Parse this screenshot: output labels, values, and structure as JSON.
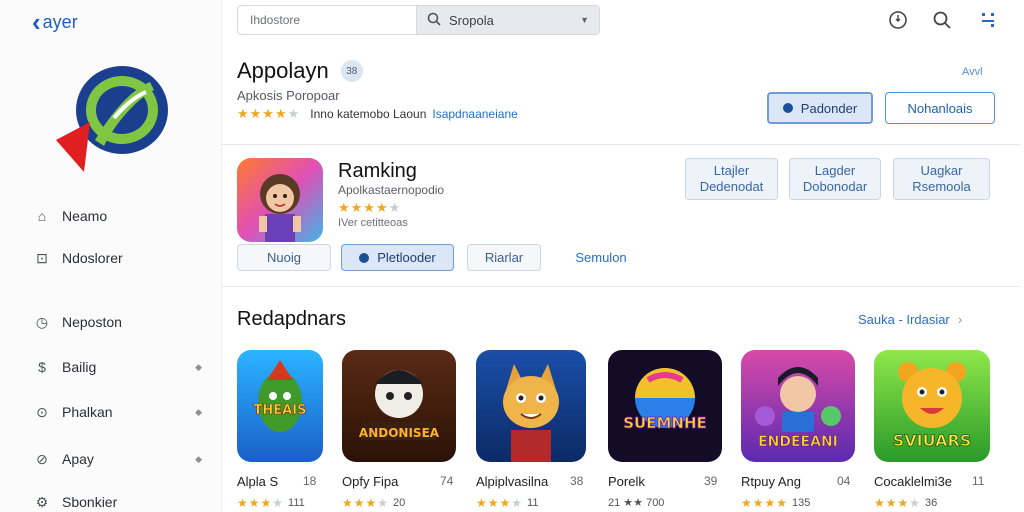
{
  "sidebar": {
    "back_label": "ayer",
    "items": [
      {
        "label": "Neamo",
        "icon": "home-icon",
        "has_arrow": false
      },
      {
        "label": "Ndoslorer",
        "icon": "square-icon",
        "has_arrow": false
      },
      {
        "label": "Neposton",
        "icon": "clock-icon",
        "has_arrow": false
      },
      {
        "label": "Bailig",
        "icon": "dollar-icon",
        "has_arrow": true
      },
      {
        "label": "Phalkan",
        "icon": "dollar-circle-icon",
        "has_arrow": true
      },
      {
        "label": "Apay",
        "icon": "compass-icon",
        "has_arrow": true
      },
      {
        "label": "Sbonkier",
        "icon": "gear-icon",
        "has_arrow": false
      }
    ]
  },
  "topbar": {
    "search_value": "Ihdostore",
    "search_scope": "Sropola"
  },
  "app": {
    "title": "Appolayn",
    "badge": "38",
    "subtitle": "Apkosis Poropoar",
    "rating_text": "Inno katemobo Laoun",
    "rating_link": "Isapdnaaneiane",
    "corner_link": "Avvl",
    "btn_primary": "Padonder",
    "btn_secondary": "Nohanloais"
  },
  "ranking": {
    "title": "Ramking",
    "subtitle": "Apolkastaernopodio",
    "meta": "IVer cetitteoas",
    "btn1": "Nuoig",
    "btn2": "Pletlooder",
    "btn3": "Riarlar",
    "btn4": "Semulon",
    "side_btn1_line1": "Ltajler",
    "side_btn1_line2": "Dedenodat",
    "side_btn2_line1": "Lagder",
    "side_btn2_line2": "Dobonodar",
    "side_btn3_line1": "Uagkar",
    "side_btn3_line2": "Rsemoola"
  },
  "recommendations": {
    "title": "Redapdnars",
    "see_all": "Sauka - Irdasiar",
    "apps": [
      {
        "name": "Alpla S",
        "num": "18",
        "rating_text": "111",
        "art_text": "THEAIS",
        "stars": 3
      },
      {
        "name": "Opfy Fipa",
        "num": "74",
        "rating_text": "20",
        "art_text": "ANDONISEA",
        "stars": 3
      },
      {
        "name": "Alpiplvasilna",
        "num": "38",
        "rating_text": "11",
        "art_text": "",
        "stars": 3
      },
      {
        "name": "Porelk",
        "num": "39",
        "rating_text": "21 ★★ 700",
        "art_text": "SUEMNHE",
        "stars": 0
      },
      {
        "name": "Rtpuy Ang",
        "num": "04",
        "rating_text": "135",
        "art_text": "ENDEEANI",
        "stars": 4
      },
      {
        "name": "Cocaklelmi3e",
        "num": "11",
        "rating_text": "36",
        "art_text": "SVIUARS",
        "stars": 3
      }
    ]
  },
  "colors": {
    "accent": "#1f5fbf",
    "star": "#f2a51f",
    "divider": "#e6e8eb"
  }
}
